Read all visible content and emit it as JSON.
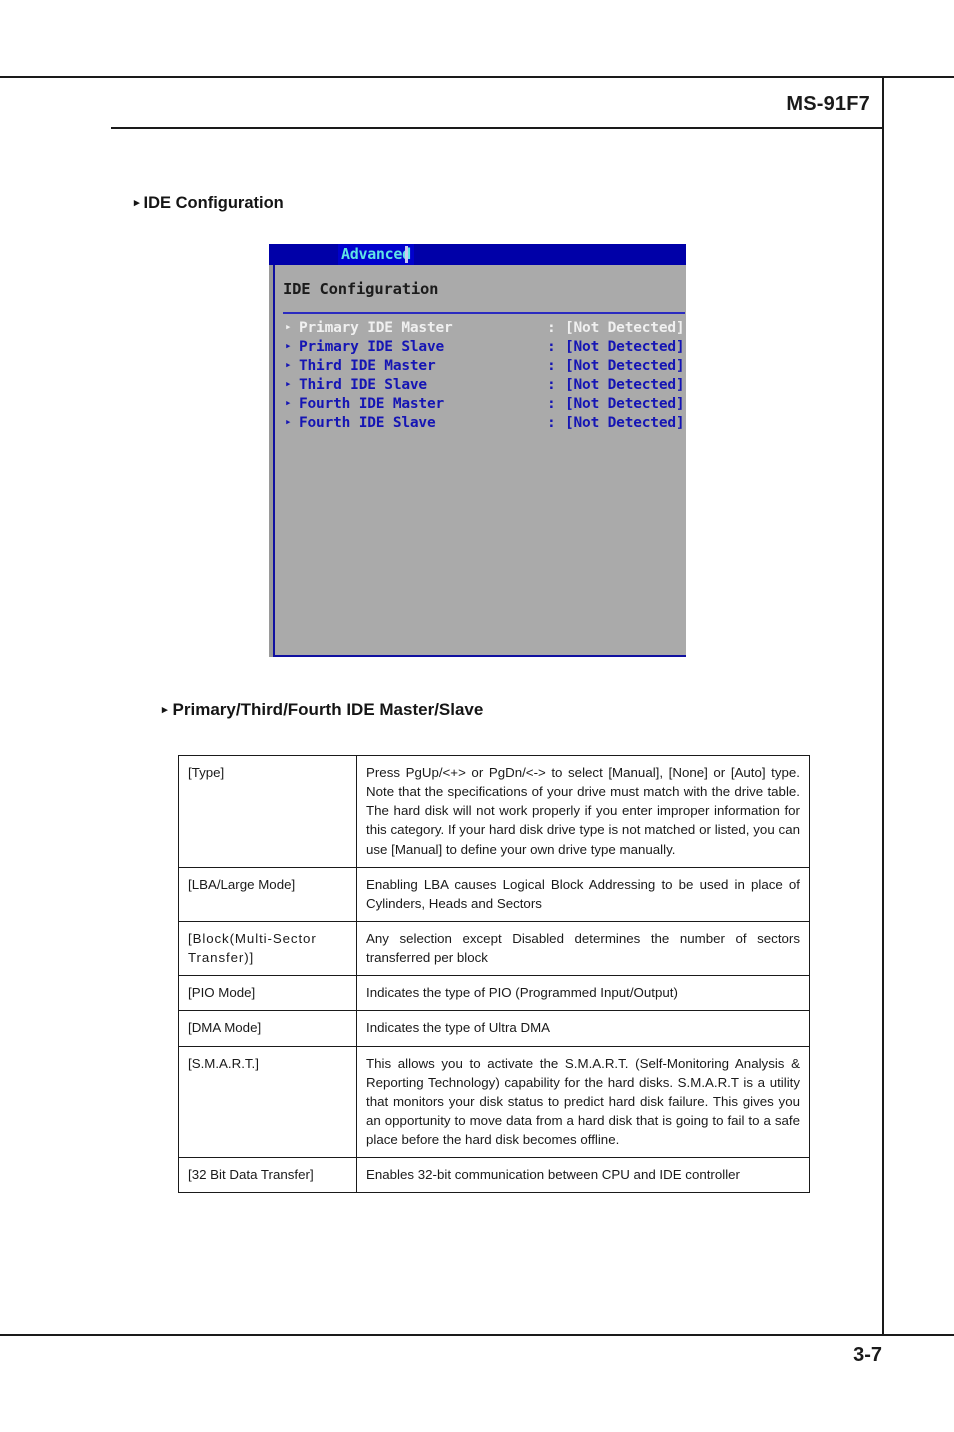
{
  "document": {
    "header_title": "MS-91F7",
    "page_number": "3-7"
  },
  "sections": {
    "ide_configuration_heading": "IDE Configuration",
    "master_slave_heading": "Primary/Third/Fourth IDE Master/Slave",
    "bullet_glyph": "▸"
  },
  "bios": {
    "tab_label": "Advanced",
    "panel_title": "IDE Configuration",
    "arrow_glyph": "▸",
    "colon": ":",
    "colors": {
      "titlebar": "#0000a8",
      "tab_background": "#0000cc",
      "tab_text": "#5fe4e4",
      "body": "#aaaaaa",
      "item_text": "#1515b4",
      "selected_text": "#f0f0f0",
      "divider": "#2b2bc0"
    },
    "items": [
      {
        "label": "Primary IDE Master",
        "value": "[Not Detected]",
        "selected": true
      },
      {
        "label": "Primary IDE Slave",
        "value": "[Not Detected]",
        "selected": false
      },
      {
        "label": "Third IDE Master",
        "value": "[Not Detected]",
        "selected": false
      },
      {
        "label": "Third IDE Slave",
        "value": "[Not Detected]",
        "selected": false
      },
      {
        "label": "Fourth IDE Master",
        "value": "[Not Detected]",
        "selected": false
      },
      {
        "label": "Fourth IDE Slave",
        "value": "[Not Detected]",
        "selected": false
      }
    ]
  },
  "description_table": {
    "rows": [
      {
        "key": "[Type]",
        "value": "Press PgUp/<+> or PgDn/<-> to select [Manual], [None] or [Auto] type. Note that the specifications of your drive must match with the drive table. The hard disk will not work properly if you enter improper information for this category. If your hard disk drive type is not matched or listed, you can use [Manual] to define your own drive type manually."
      },
      {
        "key": "[LBA/Large Mode]",
        "value": "Enabling LBA causes Logical Block Addressing to be used in place of Cylinders, Heads and Sectors"
      },
      {
        "key": "[Block(Multi-Sector Transfer)]",
        "value": "Any selection except Disabled determines the number of sectors transferred per block"
      },
      {
        "key": "[PIO Mode]",
        "value": "Indicates the type of PIO (Programmed Input/Output)"
      },
      {
        "key": "[DMA Mode]",
        "value": "Indicates the type of Ultra DMA"
      },
      {
        "key": "[S.M.A.R.T.]",
        "value": "This allows you to activate the S.M.A.R.T. (Self-Monitoring Analysis & Reporting Technology) capability for the hard disks. S.M.A.R.T is a utility that monitors your disk status to predict hard disk failure. This gives you an opportunity to move data from a hard disk that is going to fail to a safe place before the hard disk becomes offline."
      },
      {
        "key": "[32 Bit Data Transfer]",
        "value": "Enables 32-bit communication between CPU and IDE controller"
      }
    ]
  }
}
